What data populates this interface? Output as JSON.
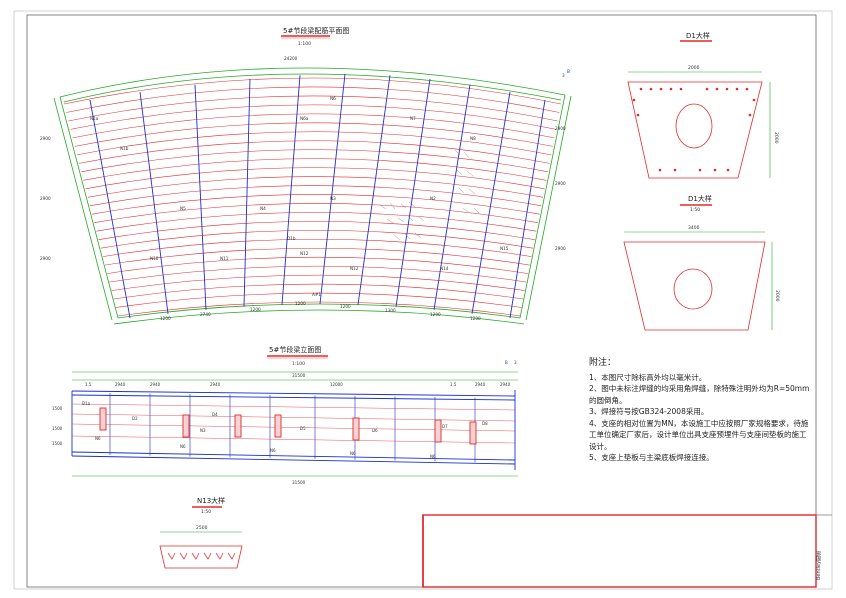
{
  "titles": {
    "plan": "5#节段梁配筋平面图",
    "plan_scale": "1:100",
    "elevation": "5#节段梁立面图",
    "elevation_scale": "1:100",
    "d1_upper": "D1大样",
    "d1_lower": "D1大样",
    "d1_lower_scale": "1:50",
    "n13": "N13大样",
    "n13_scale": "1:50"
  },
  "dims": {
    "plan_top": "24200",
    "elev_top": "31500",
    "elev_bottom": "31500",
    "d1_upper_width": "2000",
    "d1_upper_height": "2000",
    "d1_lower_width": "3400",
    "d1_lower_height": "2000",
    "n13_width": "2500"
  },
  "notes": {
    "heading": "附注：",
    "items": [
      "1、本图尺寸除标高外均以毫米计。",
      "2、图中未标注焊缝的均采用角焊缝，除特殊注明外均为R=50mm的圆倒角。",
      "3、焊接符号按GB324-2008采用。",
      "4、支座的相对位置为MN，本设施工中应按照厂家规格要求，待施工单位确定厂家后，设计单位出具支座预埋件与支座间垫板的施工设计。",
      "5、支座上垫板与主梁底板焊接连接。"
    ]
  },
  "side_text": "Bentley图纸"
}
